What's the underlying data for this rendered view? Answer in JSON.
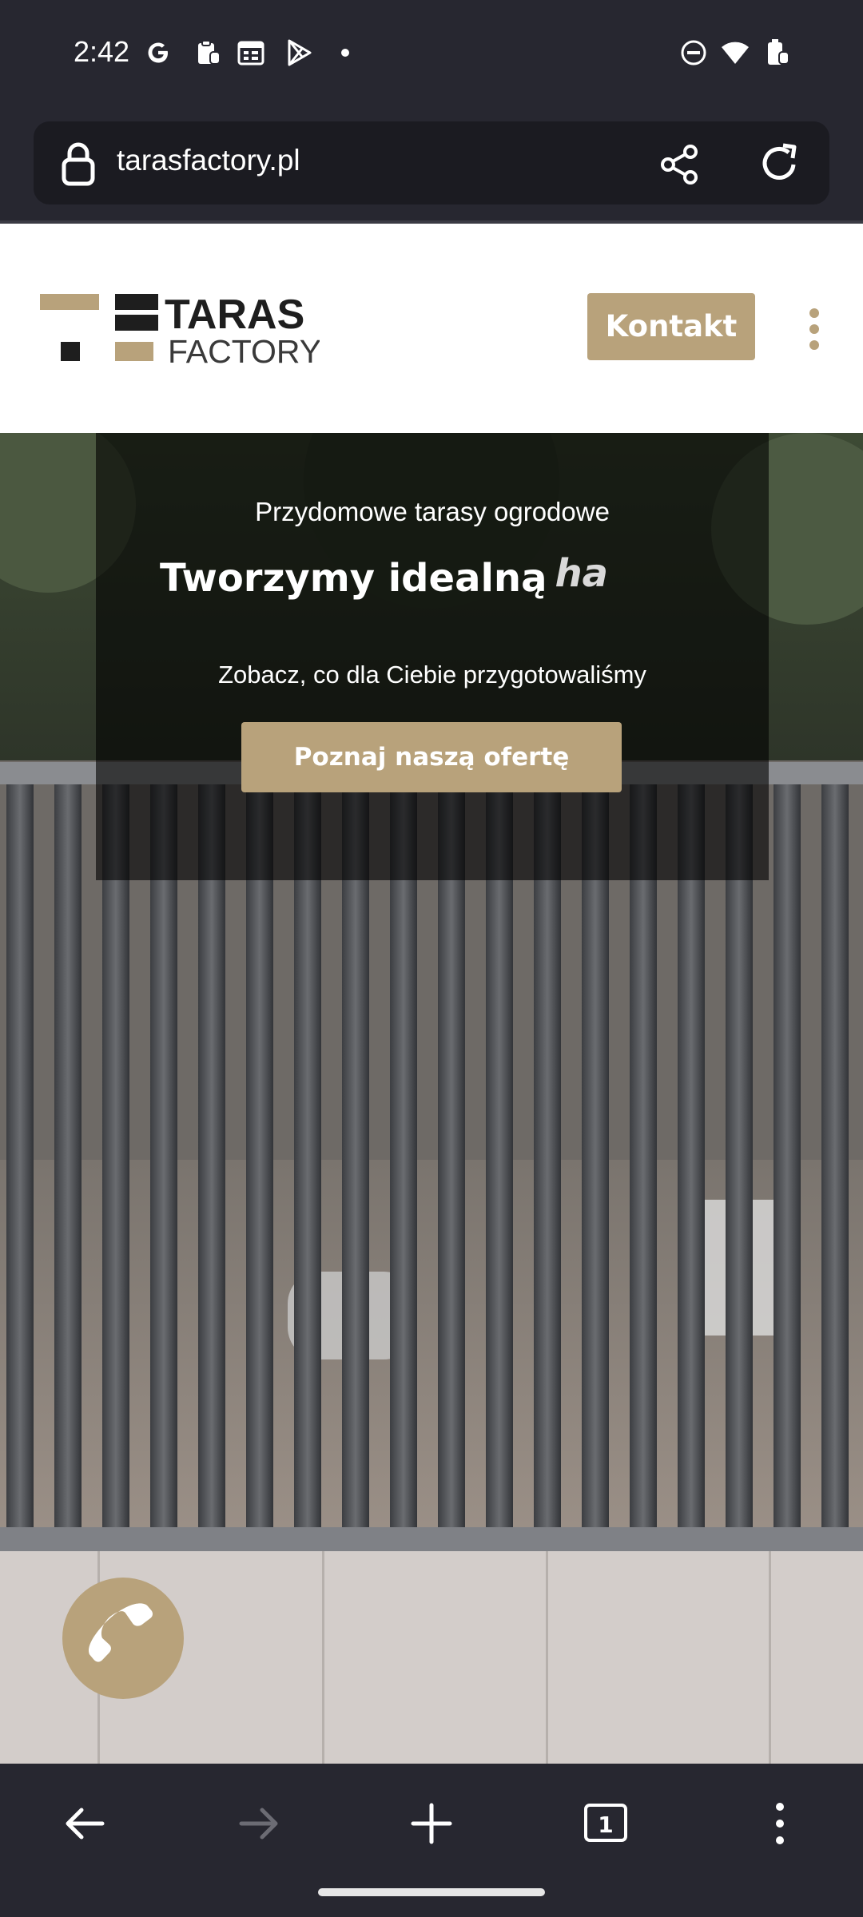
{
  "status_bar": {
    "time": "2:42",
    "icons": [
      "google-icon",
      "clipboard-icon",
      "calendar-icon",
      "play-store-icon",
      "dot-icon",
      "dnd-icon",
      "wifi-icon",
      "battery-icon"
    ]
  },
  "browser": {
    "url": "tarasfactory.pl",
    "icons": [
      "lock-icon",
      "share-icon",
      "reload-icon"
    ]
  },
  "site": {
    "logo": {
      "line1": "TARAS",
      "line2": "FACTORY"
    },
    "kontakt_label": "Kontakt",
    "accent": "#b8a27b"
  },
  "hero": {
    "subtitle": "Przydomowe tarasy ogrodowe",
    "title": "Tworzymy idealną",
    "typed": "ha",
    "description": "Zobacz, co dla Ciebie przygotowaliśmy",
    "cta": "Poznaj naszą ofertę"
  },
  "fab": {
    "icon": "phone-icon"
  },
  "bottom_nav": {
    "icons": [
      "back-arrow-icon",
      "forward-arrow-icon",
      "new-tab-icon",
      "tab-count-icon",
      "overflow-menu-icon"
    ],
    "tab_count": "1"
  }
}
